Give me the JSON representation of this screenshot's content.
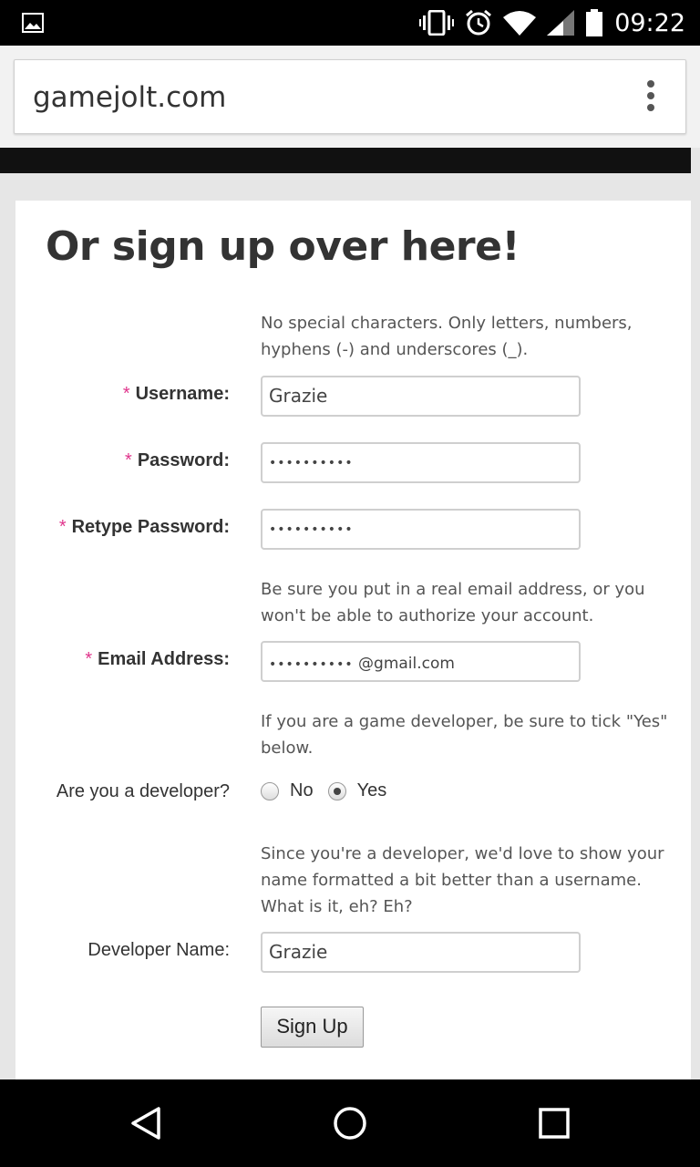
{
  "status_bar": {
    "time": "09:22",
    "icons": [
      "image-icon",
      "vibrate-icon",
      "alarm-icon",
      "wifi-icon",
      "signal-icon",
      "battery-icon"
    ]
  },
  "browser": {
    "url": "gamejolt.com",
    "menu_icon": "overflow-menu-icon"
  },
  "form": {
    "heading": "Or sign up over here!",
    "username_hint": "No special characters. Only letters, numbers, hyphens (-) and underscores (_).",
    "username_label": "Username:",
    "username_value": "Grazie",
    "password_label": "Password:",
    "password_value": "••••••••••",
    "retype_label": "Retype Password:",
    "retype_value": "••••••••••",
    "email_hint": "Be sure you put in a real email address, or you won't be able to authorize your account.",
    "email_label": "Email Address:",
    "email_masked": "••••••••••",
    "email_suffix": "@gmail.com",
    "developer_hint": "If you are a game developer, be sure to tick \"Yes\" below.",
    "developer_question": "Are you a developer?",
    "radio_no": "No",
    "radio_yes": "Yes",
    "radio_selected": "Yes",
    "dev_name_hint": "Since you're a developer, we'd love to show your name formatted a bit better than a username. What is it, eh? Eh?",
    "dev_name_label": "Developer Name:",
    "dev_name_value": "Grazie",
    "submit_label": "Sign Up",
    "required_marker": "*",
    "required_color": "#e0358c"
  },
  "nav_bar": {
    "back": "back-icon",
    "home": "home-icon",
    "recents": "recents-icon"
  }
}
